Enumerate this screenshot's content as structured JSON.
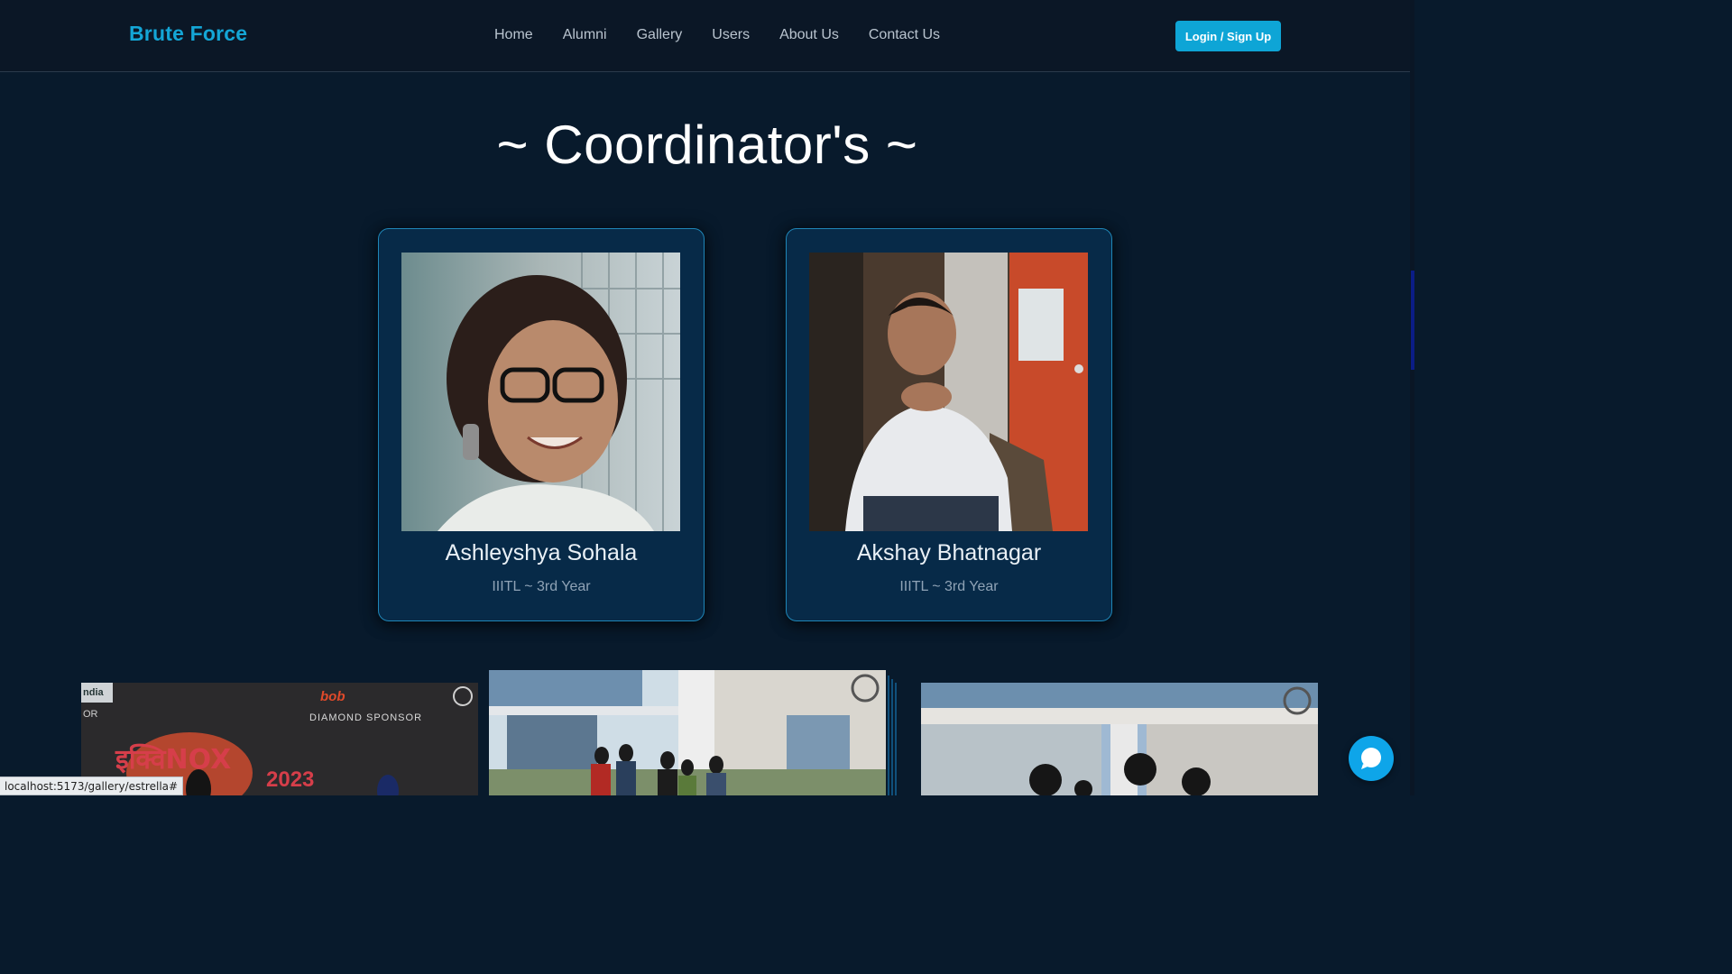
{
  "nav": {
    "brand": "Brute Force",
    "links": [
      "Home",
      "Alumni",
      "Gallery",
      "Users",
      "About Us",
      "Contact Us"
    ],
    "login_label": "Login / Sign Up"
  },
  "heading": "~ Coordinator's ~",
  "coordinators": [
    {
      "name": "Ashleyshya Sohala",
      "subtitle": "IIITL ~ 3rd Year"
    },
    {
      "name": "Akshay Bhatnagar",
      "subtitle": "IIITL ~ 3rd Year"
    }
  ],
  "gallery": {
    "banner_left": "ndia",
    "banner_left_sub": "OR",
    "sponsor_logo": "bob",
    "sponsor_label": "DIAMOND SPONSOR",
    "event_title": "इक्विNOX",
    "event_year": "2023"
  },
  "status_bar": "localhost:5173/gallery/estrella#",
  "colors": {
    "background": "#081a2c",
    "navbar": "#0b1726",
    "brand": "#14a6d6",
    "button": "#0ea5d6",
    "card": "#072a48",
    "card_border": "#1f86b8",
    "chat": "#0ea5e9"
  },
  "icons": [
    "chat-icon",
    "carousel-next-icon",
    "college-logo-icon"
  ]
}
